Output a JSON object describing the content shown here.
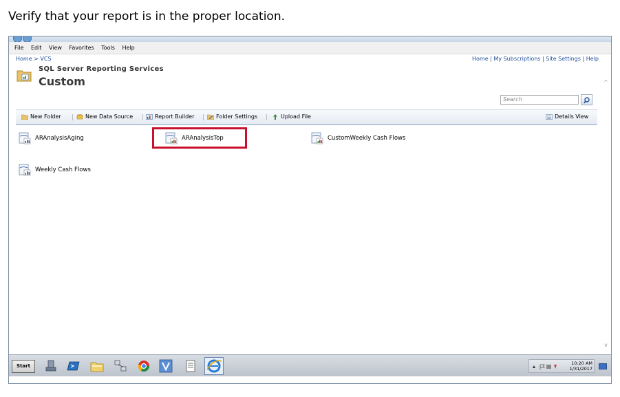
{
  "instruction": "Verify that your report is in the proper location.",
  "menu": [
    "File",
    "Edit",
    "View",
    "Favorites",
    "Tools",
    "Help"
  ],
  "breadcrumb": "Home > VCS",
  "top_links": "Home | My Subscriptions | Site Settings | Help",
  "app_name": "SQL Server Reporting Services",
  "folder_name": "Custom",
  "search": {
    "placeholder": "Search",
    "icon": "magnifier-icon"
  },
  "toolbar": {
    "new_folder": "New Folder",
    "new_data_source": "New Data Source",
    "report_builder": "Report Builder",
    "folder_settings": "Folder Settings",
    "upload_file": "Upload File",
    "details_view": "Details View"
  },
  "reports": [
    {
      "name": "ARAnalysisAging"
    },
    {
      "name": "ARAnalysisTop",
      "highlighted": true
    },
    {
      "name": "CustomWeekly Cash Flows"
    },
    {
      "name": "Weekly Cash Flows"
    }
  ],
  "taskbar": {
    "start": "Start",
    "time": "10:20 AM",
    "date": "1/31/2017"
  },
  "colors": {
    "highlight": "#c8102e",
    "link": "#1f4e9a"
  }
}
